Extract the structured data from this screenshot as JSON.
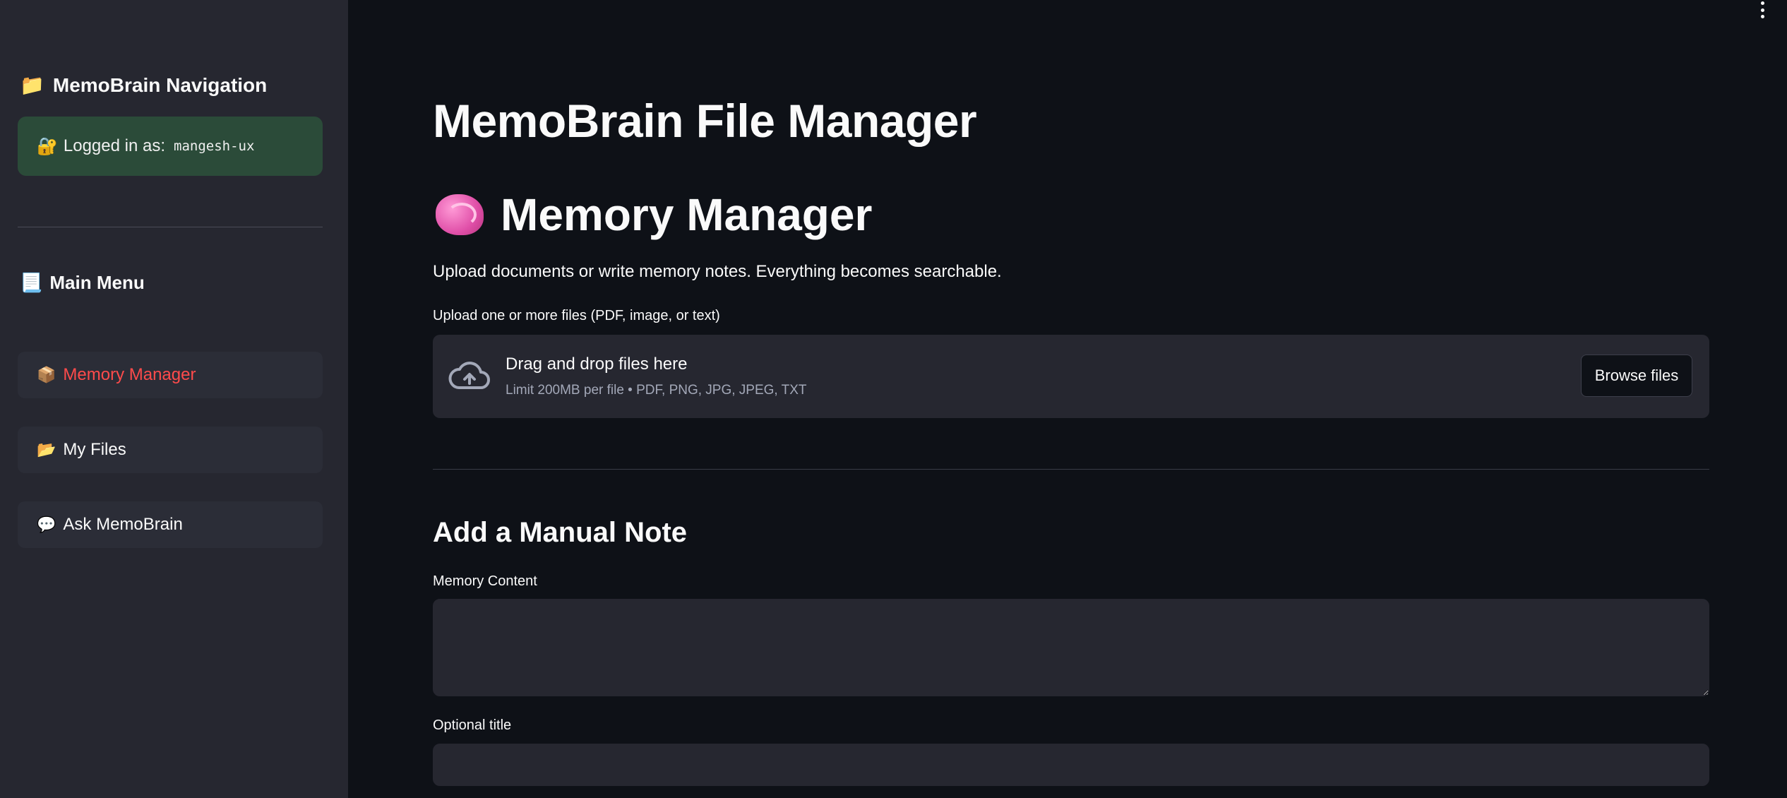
{
  "sidebar": {
    "heading": "MemoBrain Navigation",
    "heading_icon": "folder-icon",
    "login": {
      "icon": "lock-icon",
      "label": "Logged in as:",
      "username": "mangesh-ux",
      "bg_color": "#2b4b39"
    },
    "menu_heading": "Main Menu",
    "menu_icon": "scroll-icon",
    "items": [
      {
        "label": "Memory Manager",
        "icon": "package-icon",
        "active": true
      },
      {
        "label": "My Files",
        "icon": "folder-icon",
        "active": false
      },
      {
        "label": "Ask MemoBrain",
        "icon": "speech-bubble-icon",
        "active": false
      }
    ]
  },
  "main": {
    "page_title": "MemoBrain File Manager",
    "section_title": "Memory Manager",
    "section_icon": "brain-icon",
    "description": "Upload documents or write memory notes. Everything becomes searchable.",
    "uploader": {
      "label": "Upload one or more files (PDF, image, or text)",
      "drag_text": "Drag and drop files here",
      "limit_text": "Limit 200MB per file • PDF, PNG, JPG, JPEG, TXT",
      "browse_label": "Browse files",
      "icon": "cloud-upload-icon"
    },
    "note": {
      "title": "Add a Manual Note",
      "content_label": "Memory Content",
      "content_value": "",
      "title_label": "Optional title",
      "title_value": ""
    }
  },
  "colors": {
    "background": "#0e1117",
    "sidebar": "#262730",
    "active_accent": "#ff4b4b",
    "text": "#fafafa"
  }
}
